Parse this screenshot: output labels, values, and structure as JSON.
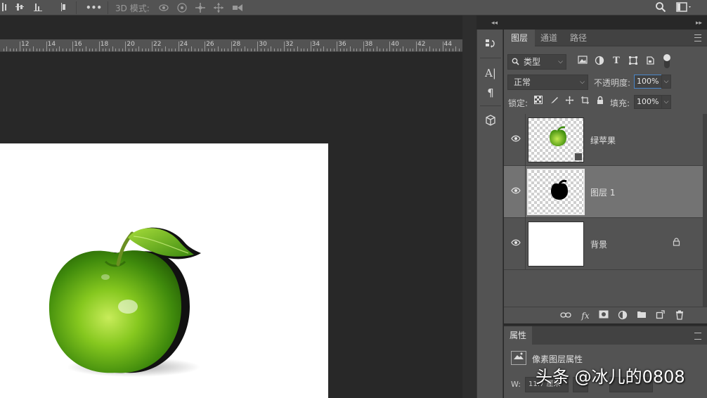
{
  "option_bar": {
    "mode_label": "3D 模式:",
    "more_icon": "more-icon",
    "icons": [
      "align-top-icon",
      "align-middle-icon",
      "align-bottom-icon",
      "distribute-icon",
      "orbit-3d-icon",
      "roll-3d-icon",
      "pan-3d-icon",
      "slide-3d-icon",
      "scale-3d-icon",
      "search-icon",
      "workspace-icon"
    ]
  },
  "ruler": {
    "labels": [
      "12",
      "14",
      "16",
      "18",
      "20",
      "22",
      "24",
      "26",
      "28",
      "30",
      "32",
      "34",
      "36",
      "38",
      "40",
      "42",
      "44"
    ]
  },
  "layers_panel": {
    "tabs": [
      "图层",
      "通道",
      "路径"
    ],
    "filter": {
      "label": "类型"
    },
    "blend_mode": "正常",
    "opacity_label": "不透明度:",
    "opacity_value": "100%",
    "lock_label": "锁定:",
    "fill_label": "填充:",
    "fill_value": "100%",
    "layers": [
      {
        "name": "绿苹果",
        "visible": true,
        "selected": false,
        "smart_object": true,
        "thumbnail": "green-apple"
      },
      {
        "name": "图层 1",
        "visible": true,
        "selected": true,
        "smart_object": false,
        "thumbnail": "black-apple-silhouette"
      },
      {
        "name": "背景",
        "visible": true,
        "selected": false,
        "locked": true,
        "thumbnail": "white"
      }
    ]
  },
  "properties_panel": {
    "tab": "属性",
    "title": "像素图层属性",
    "w_label": "W:",
    "w_value": "11.7 厘米"
  },
  "watermark": "头条 @冰儿的0808",
  "colors": {
    "panel_bg": "#535353",
    "canvas_bg": "#282828",
    "selected_layer": "#737373",
    "apple_green": "#7cc11f"
  }
}
